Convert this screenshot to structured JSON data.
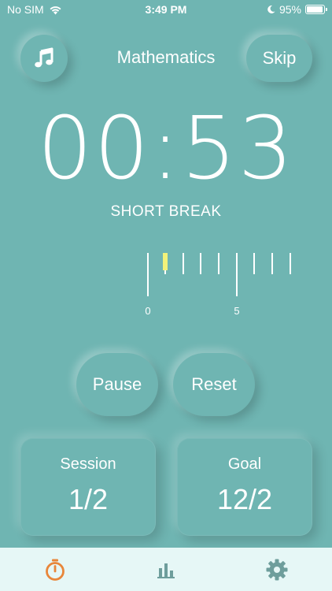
{
  "status_bar": {
    "carrier": "No SIM",
    "time": "3:49 PM",
    "battery_percent": "95%",
    "battery_level": 0.95,
    "icons": [
      "wifi-icon",
      "moon-icon",
      "battery-icon"
    ]
  },
  "header": {
    "music_icon": "music-note-icon",
    "title": "Mathematics",
    "skip_label": "Skip"
  },
  "timer": {
    "display": "00:53",
    "mode": "SHORT BREAK"
  },
  "ruler": {
    "labels": [
      "0",
      "5"
    ],
    "current_minute": 1
  },
  "controls": {
    "pause_label": "Pause",
    "reset_label": "Reset"
  },
  "stats": {
    "session_label": "Session",
    "session_value": "1/2",
    "goal_label": "Goal",
    "goal_value": "12/2"
  },
  "tabs": [
    {
      "icon": "timer-icon",
      "active": true
    },
    {
      "icon": "bar-chart-icon",
      "active": false
    },
    {
      "icon": "gear-icon",
      "active": false
    }
  ],
  "colors": {
    "background": "#6FB5B2",
    "tab_bar": "#E6F7F6",
    "active_tab": "#E8863A",
    "inactive_tab": "#6E9E9C",
    "ruler_marker": "#F2F27A"
  }
}
